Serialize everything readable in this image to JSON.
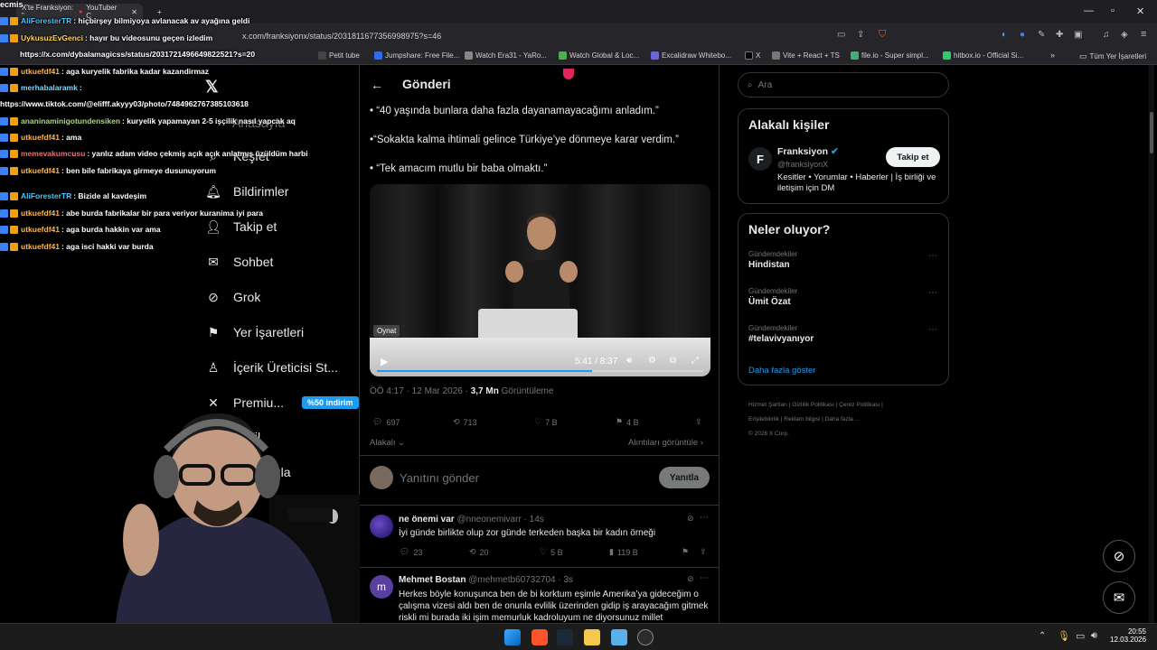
{
  "browser": {
    "tabs": [
      {
        "label": "X'te Franksiyon: \""
      },
      {
        "label": "YouTuber C"
      }
    ],
    "new_tab": "+",
    "url": "x.com/franksiyonx/status/2031811677356998975?s=46",
    "bookmarks": [
      {
        "label": "Petit tube",
        "color": "#444"
      },
      {
        "label": "Jumpshare: Free File...",
        "color": "#2a6df4"
      },
      {
        "label": "Watch Era31 - YaRo...",
        "color": "#888"
      },
      {
        "label": "Watch Global & Loc...",
        "color": "#4caf50"
      },
      {
        "label": "Excalidraw Whitebo...",
        "color": "#6965db"
      },
      {
        "label": "X",
        "color": "#000"
      },
      {
        "label": "Vite + React + TS",
        "color": "#777"
      },
      {
        "label": "file.io - Super simpl...",
        "color": "#3cb371"
      },
      {
        "label": "hitbox.io - Official Si...",
        "color": "#2ecc71"
      }
    ],
    "all_bookmarks": "Tüm Yer İşaretleri"
  },
  "nav": {
    "items": [
      {
        "label": "Keşfet",
        "icon": "search-icon"
      },
      {
        "label": "Bildirimler",
        "icon": "bell-icon"
      },
      {
        "label": "Takip et",
        "icon": "add-user-icon"
      },
      {
        "label": "Sohbet",
        "icon": "mail-icon"
      },
      {
        "label": "Grok",
        "icon": "grok-icon"
      },
      {
        "label": "Yer İşaretleri",
        "icon": "bookmark-icon"
      },
      {
        "label": "İçerik Üreticisi St...",
        "icon": "creator-icon"
      },
      {
        "label": "Premiu...",
        "icon": "x-icon"
      },
      {
        "label": "fil",
        "icon": "profile-icon"
      },
      {
        "label": "fazla",
        "icon": "more-icon"
      }
    ],
    "premium_badge": "%50 indirim",
    "partial": "Anasayfa"
  },
  "post": {
    "header": "Gönderi",
    "bullets": [
      "• “40 yaşında bunlara daha fazla dayanamayacağımı anladım.”",
      "•“Sokakta kalma ihtimali gelince Türkiye’ye dönmeye karar verdim.”",
      "• “Tek amacım mutlu bir baba olmaktı.”"
    ],
    "video": {
      "tooltip": "Oynat",
      "time": "5:41 / 8:37",
      "progress": 0.66
    },
    "meta_time": "ÖÖ 4:17 · 12 Mar 2026 · ",
    "meta_views": "3,7 Mn",
    "meta_views_label": " Görüntüleme",
    "stats": {
      "replies": "697",
      "reposts": "713",
      "likes": "7 B",
      "bookmarks": "4 B"
    },
    "relevant": "Alakalı",
    "quotes": "Alıntıları görüntüle",
    "reply_placeholder": "Yanıtını gönder",
    "reply_button": "Yanıtla"
  },
  "replies": [
    {
      "name": "ne önemi var",
      "handle": "@nneonemivarr · 14s",
      "text": "İyi günde birlikte olup zor günde terkeden başka bir kadın örneği",
      "stats": {
        "replies": "23",
        "reposts": "20",
        "likes": "5 B",
        "views": "119 B"
      }
    },
    {
      "name": "Mehmet Bostan",
      "handle": "@mehmetb60732704 · 3s",
      "avatar": "m",
      "text": "Herkes böyle konuşunca ben de bi korktum eşimle Amerika’ya gideceğim o çalışma vizesi aldı ben de onunla evlilik üzerinden gidip iş arayacağım gitmek riskli mi burada iki işim memurluk kadroluyum ne diyorsunuz millet"
    }
  ],
  "sidebar": {
    "search_placeholder": "Ara",
    "related_title": "Alakalı kişiler",
    "account_name": "Franksiyon",
    "account_handle": "@franksiyonX",
    "account_bio": "Kesitler • Yorumlar • Haberler | İş birliği ve iletişim için DM",
    "follow_button": "Takip et",
    "trends_title": "Neler oluyor?",
    "trends": [
      {
        "category": "Gündemdekiler",
        "name": "Hindistan"
      },
      {
        "category": "Gündemdekiler",
        "name": "Ümit Özat"
      },
      {
        "category": "Gündemdekiler",
        "name": "#telavivyanıyor"
      }
    ],
    "show_more": "Daha fazla göster",
    "footer": [
      "Hizmet Şartları",
      "Gizlilik Politikası",
      "Çerez Politikası",
      "Erişilebilirlik",
      "Reklam bilgisi",
      "Daha fazla ...",
      "© 2026 X Corp."
    ]
  },
  "chat": [
    {
      "user": "AliForesterTR",
      "color": "#4fc3f7",
      "msg": ": hiçbirşey bilmiyoya avlanacak av ayağına geldi"
    },
    {
      "user": "UykusuzEvGenci",
      "color": "#ffd54f",
      "msg": ": hayır bu videosunu geçen izledim"
    },
    {
      "user": "",
      "color": "#fff",
      "msg": "https://x.com/dybalamagicss/status/2031721496649822521?s=20"
    },
    {
      "user": "utkuefdf41",
      "color": "#ffb74d",
      "msg": ": aga kuryelik fabrika kadar kazandirmaz"
    },
    {
      "user": "merhabalaramk",
      "color": "#81d4fa",
      "msg": ":"
    },
    {
      "user": "",
      "color": "#fff",
      "msg": "https://www.tiktok.com/@elifff.akyyy03/photo/7484962767385103618"
    },
    {
      "user": "ananinaminigotundensiken",
      "color": "#aed581",
      "msg": ": kuryelik yapamayan 2-5 işçilik nasıl yapcak aq"
    },
    {
      "user": "utkuefdf41",
      "color": "#ffb74d",
      "msg": ": ama"
    },
    {
      "user": "memevakumcusu",
      "color": "#e57373",
      "msg": ": yanlız adam video çekmiş açık açık anlatmış üzüldüm harbi"
    },
    {
      "user": "utkuefdf41",
      "color": "#ffb74d",
      "msg": ": ben bile fabrikaya girmeye dusunuyorum"
    },
    {
      "user": "AliForesterTR",
      "color": "#4fc3f7",
      "msg": ": Bizide al kavdeşim"
    },
    {
      "user": "utkuefdf41",
      "color": "#ffb74d",
      "msg": ": abe burda fabrikalar bir para veriyor kuranima iyi para"
    },
    {
      "user": "utkuefdf41",
      "color": "#ffb74d",
      "msg": ": aga burda hakkin var ama"
    },
    {
      "user": "utkuefdf41",
      "color": "#ffb74d",
      "msg": ": aga isci hakki var burda"
    }
  ],
  "chat_header": "ecmis",
  "taskbar": {
    "time": "20:55",
    "date": "12.03.2026"
  }
}
